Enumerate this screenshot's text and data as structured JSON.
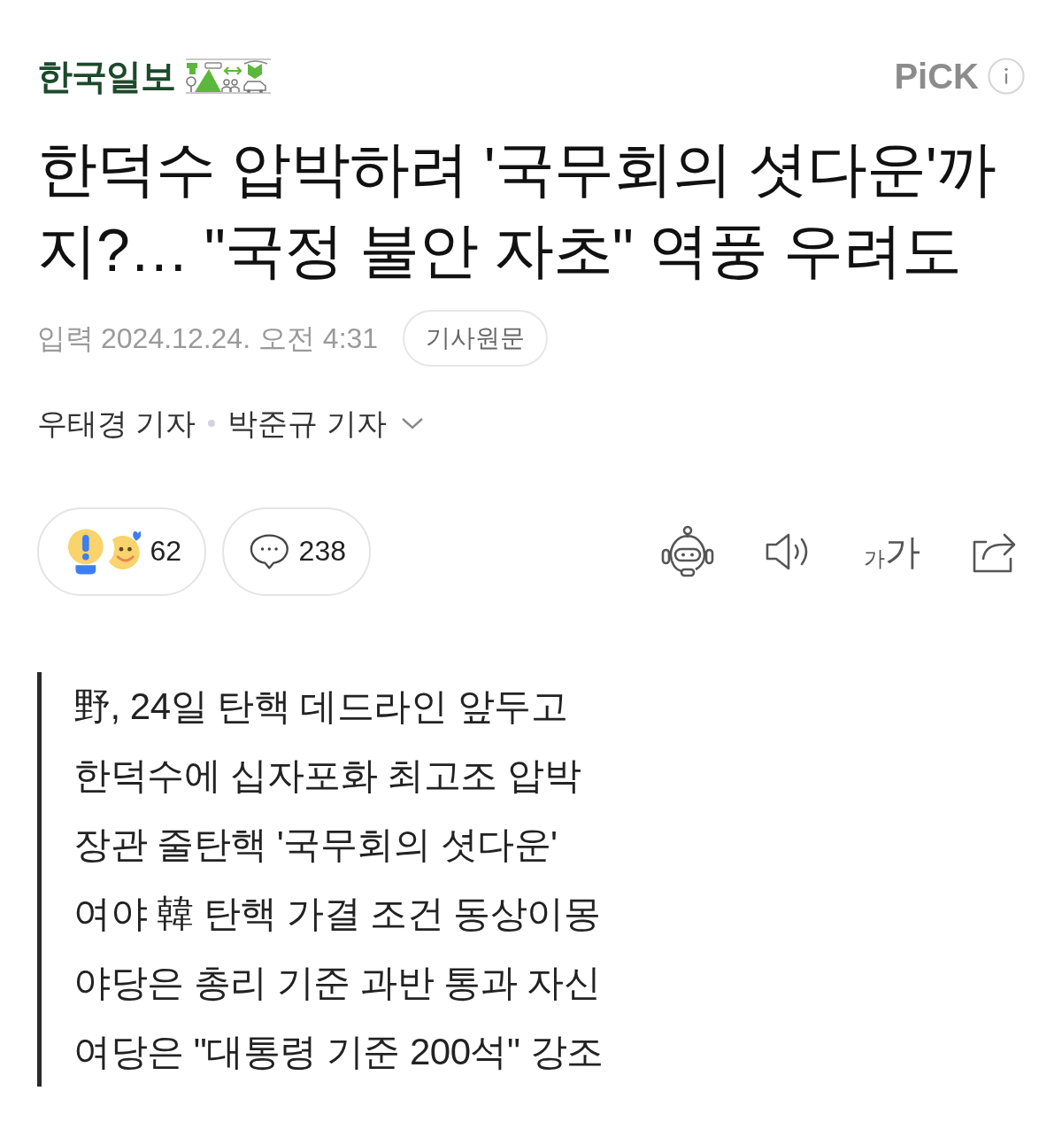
{
  "header": {
    "logo": "한국일보",
    "pick_label": "PiCK"
  },
  "headline": "한덕수 압박하려 '국무회의 셧다운'까지?… \"국정 불안 자초\" 역풍 우려도",
  "meta": {
    "label": "입력",
    "timestamp": "2024.12.24. 오전 4:31",
    "original_link": "기사원문"
  },
  "byline": {
    "authors": [
      "우태경 기자",
      "박준규 기자"
    ],
    "expanded": false
  },
  "actions": {
    "reaction_count": "62",
    "comment_count": "238",
    "font_size_label": {
      "small": "가",
      "large": "가"
    }
  },
  "summary": [
    "野, 24일 탄핵 데드라인 앞두고",
    "한덕수에 십자포화 최고조 압박",
    "장관 줄탄핵 '국무회의 셧다운'",
    "여야 韓 탄핵 가결 조건 동상이몽",
    "야당은 총리 기준 과반 통과 자신",
    "여당은 \"대통령 기준 200석\" 강조"
  ]
}
